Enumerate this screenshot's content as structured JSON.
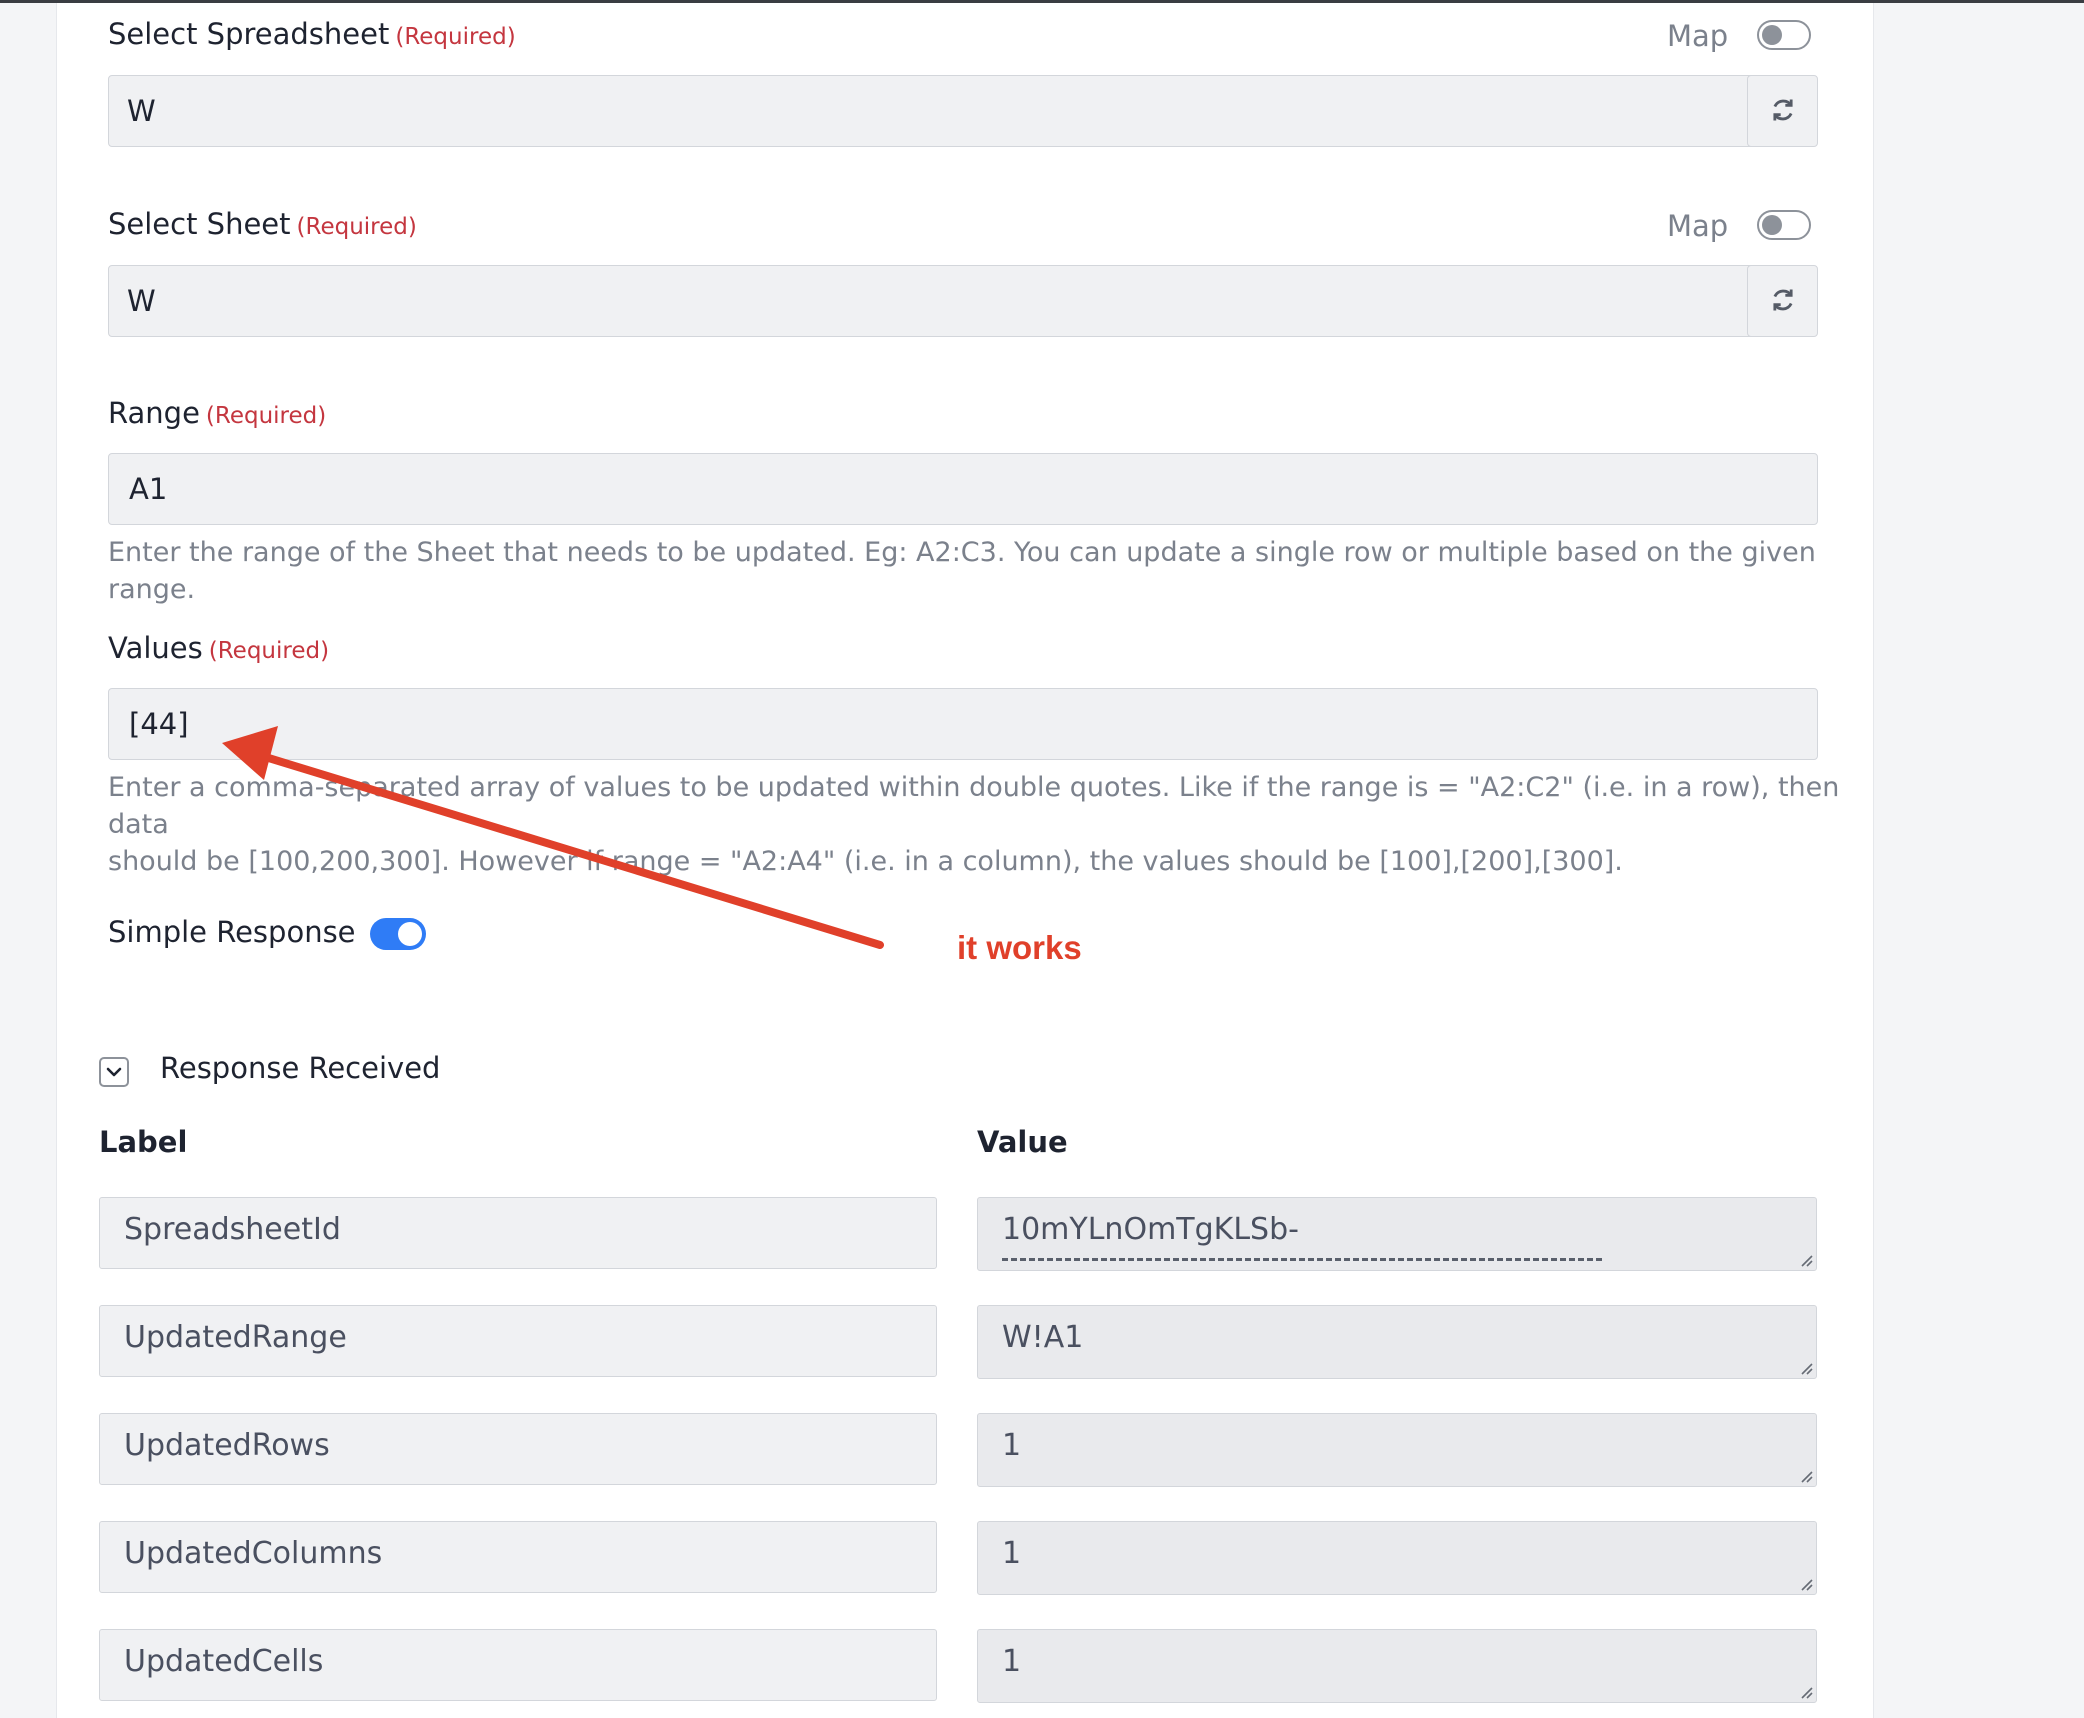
{
  "spreadsheet": {
    "label": "Select Spreadsheet",
    "required": "(Required)",
    "map_label": "Map",
    "value": "W"
  },
  "sheet": {
    "label": "Select Sheet",
    "required": "(Required)",
    "map_label": "Map",
    "value": "W"
  },
  "range": {
    "label": "Range",
    "required": "(Required)",
    "value": "A1",
    "help": "Enter the range of the Sheet that needs to be updated. Eg: A2:C3. You can update a single row or multiple based on the given range."
  },
  "values": {
    "label": "Values",
    "required": "(Required)",
    "value": "[44]",
    "help_line1": "Enter a comma-separated array of values to be updated within double quotes. Like if the range is = \"A2:C2\" (i.e. in a row), then data",
    "help_line2": "should be [100,200,300]. However if range = \"A2:A4\" (i.e. in a column), the values should be [100],[200],[300]."
  },
  "simple_response": {
    "label": "Simple Response",
    "enabled": true
  },
  "annotation": {
    "text": "it works",
    "color": "#e0402a"
  },
  "response": {
    "title": "Response Received",
    "col_label": "Label",
    "col_value": "Value",
    "rows": [
      {
        "label": "SpreadsheetId",
        "value": "10mYLnOmTgKLSb-"
      },
      {
        "label": "UpdatedRange",
        "value": "W!A1"
      },
      {
        "label": "UpdatedRows",
        "value": "1"
      },
      {
        "label": "UpdatedColumns",
        "value": "1"
      },
      {
        "label": "UpdatedCells",
        "value": "1"
      }
    ]
  },
  "colors": {
    "accent": "#2f7cf6",
    "required": "#c4363f"
  }
}
